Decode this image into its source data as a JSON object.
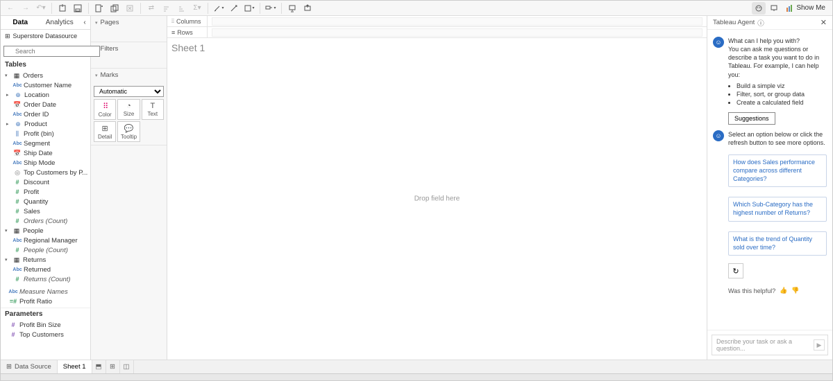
{
  "toolbar": {
    "show_me": "Show Me"
  },
  "left": {
    "tabs": {
      "data": "Data",
      "analytics": "Analytics"
    },
    "datasource": "Superstore Datasource",
    "search_placeholder": "Search",
    "tables_header": "Tables",
    "tables": {
      "orders": {
        "name": "Orders",
        "fields": [
          {
            "icon": "abc",
            "label": "Customer Name"
          },
          {
            "icon": "geo",
            "label": "Location",
            "expandable": true
          },
          {
            "icon": "date",
            "label": "Order Date"
          },
          {
            "icon": "abc",
            "label": "Order ID"
          },
          {
            "icon": "geo",
            "label": "Product",
            "expandable": true
          },
          {
            "icon": "bin",
            "label": "Profit (bin)"
          },
          {
            "icon": "abc",
            "label": "Segment"
          },
          {
            "icon": "date",
            "label": "Ship Date"
          },
          {
            "icon": "abc",
            "label": "Ship Mode"
          },
          {
            "icon": "set",
            "label": "Top Customers by P..."
          },
          {
            "icon": "num",
            "label": "Discount"
          },
          {
            "icon": "num",
            "label": "Profit"
          },
          {
            "icon": "num",
            "label": "Quantity"
          },
          {
            "icon": "num",
            "label": "Sales"
          },
          {
            "icon": "num",
            "label": "Orders (Count)",
            "italic": true
          }
        ]
      },
      "people": {
        "name": "People",
        "fields": [
          {
            "icon": "abc",
            "label": "Regional Manager"
          },
          {
            "icon": "num",
            "label": "People (Count)",
            "italic": true
          }
        ]
      },
      "returns": {
        "name": "Returns",
        "fields": [
          {
            "icon": "abc",
            "label": "Returned"
          },
          {
            "icon": "num",
            "label": "Returns (Count)",
            "italic": true
          }
        ]
      }
    },
    "extra_fields": [
      {
        "icon": "abc",
        "label": "Measure Names",
        "italic": true
      },
      {
        "icon": "numcalc",
        "label": "Profit Ratio"
      }
    ],
    "params_header": "Parameters",
    "params": [
      {
        "icon": "num",
        "label": "Profit Bin Size"
      },
      {
        "icon": "num",
        "label": "Top Customers"
      }
    ]
  },
  "shelves": {
    "pages": "Pages",
    "filters": "Filters",
    "marks": "Marks",
    "mark_type": "Automatic",
    "cells": {
      "color": "Color",
      "size": "Size",
      "text": "Text",
      "detail": "Detail",
      "tooltip": "Tooltip"
    }
  },
  "canvas": {
    "columns": "Columns",
    "rows": "Rows",
    "sheet_title": "Sheet 1",
    "drop_hint": "Drop field here"
  },
  "agent": {
    "title": "Tableau Agent",
    "intro1": "What can I help you with?",
    "intro2": "You can ask me questions or describe a task you want to do in Tableau. For example, I can help you:",
    "bullets": [
      "Build a simple viz",
      "Filter, sort, or group data",
      "Create a calculated field"
    ],
    "suggestions_btn": "Suggestions",
    "select_hint": "Select an option below or click the refresh button to see more options.",
    "suggestions": [
      "How does Sales performance compare across different Categories?",
      "Which Sub-Category has the highest number of Returns?",
      "What is the trend of Quantity sold over time?"
    ],
    "helpful": "Was this helpful?",
    "placeholder": "Describe your task or ask a question..."
  },
  "footer": {
    "data_source": "Data Source",
    "sheet": "Sheet 1"
  }
}
